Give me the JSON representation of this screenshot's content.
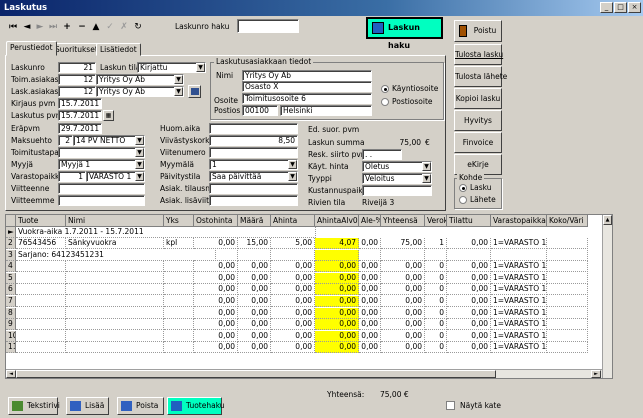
{
  "window": {
    "title": "Laskutus",
    "controls": [
      "_",
      "□",
      "×"
    ]
  },
  "toolbar": {
    "icons": [
      "first-icon",
      "prev-icon",
      "next-icon",
      "last-icon",
      "add-icon",
      "delete-icon",
      "up-icon",
      "check-icon",
      "cancel-icon",
      "refresh-icon"
    ],
    "search_label": "Laskunro haku",
    "search_value": "",
    "search_button": "Laskun haku"
  },
  "right_buttons": {
    "poistu": "Poistu",
    "tulosta_lasku": "Tulosta lasku",
    "tulosta_lahete": "Tulosta lähete",
    "kopioi_lasku": "Kopioi lasku",
    "hyvitys": "Hyvitys",
    "finvoice": "Finvoice",
    "ekirje": "eKirje"
  },
  "kohde": {
    "title": "Kohde",
    "options": [
      "Lasku",
      "Lähete"
    ],
    "selected": "Lasku"
  },
  "tabs": [
    "Perustiedot",
    "Suoritukset",
    "Lisätiedot"
  ],
  "form": {
    "laskunro": {
      "label": "Laskunro",
      "value": "21"
    },
    "laskun_tila": {
      "label": "Laskun tila",
      "value": "Kirjattu"
    },
    "toim_asiakas": {
      "label": "Toim.asiakas",
      "num": "12",
      "name": "Yritys Oy Ab"
    },
    "lask_asiakas": {
      "label": "Lask.asiakas",
      "num": "12",
      "name": "Yritys Oy Ab"
    },
    "kirjaus_pvm": {
      "label": "Kirjaus pvm",
      "value": "15.7.2011"
    },
    "laskutus_pvm": {
      "label": "Laskutus pvm",
      "value": "15.7.2011"
    },
    "erapvm": {
      "label": "Eräpvm",
      "value": "29.7.2011"
    },
    "maksuehto": {
      "label": "Maksuehto",
      "num": "2",
      "value": "14 PV NETTO"
    },
    "toimitustapa": {
      "label": "Toimitustapa",
      "value": ""
    },
    "myyja": {
      "label": "Myyjä",
      "value": "Myyjä 1"
    },
    "varastopaikka": {
      "label": "Varastopaikka",
      "num": "1",
      "value": "VARASTO 1"
    },
    "viitteenne": {
      "label": "Viitteenne",
      "value": ""
    },
    "viitteemme": {
      "label": "Viitteemme",
      "value": ""
    },
    "huom_aika": {
      "label": "Huom.aika",
      "value": ""
    },
    "viivastyskorko": {
      "label": "Viivästyskorko",
      "value": "8,50"
    },
    "viitenumero": {
      "label": "Viitenumero",
      "value": ""
    },
    "myymala": {
      "label": "Myymälä",
      "value": "1"
    },
    "paivitystila": {
      "label": "Päivitystila",
      "value": "Saa päivittää"
    },
    "asiak_tilausnro": {
      "label": "Asiak. tilausnro",
      "value": ""
    },
    "asiak_lisaviite": {
      "label": "Asiak. lisäviite",
      "value": ""
    },
    "ed_suor_pvm": {
      "label": "Ed. suor. pvm",
      "value": ""
    },
    "laskun_summa": {
      "label": "Laskun summa",
      "value": "75,00",
      "unit": "€"
    },
    "resk_siirto_pvm": {
      "label": "Resk. siirto pvm",
      "value": ". ."
    },
    "kayt_hinta": {
      "label": "Käyt. hinta",
      "value": "Oletus"
    },
    "tyyppi": {
      "label": "Tyyppi",
      "value": "Veloitus"
    },
    "kustannuspaik": {
      "label": "Kustannuspaik.",
      "value": ""
    },
    "rivien_tila": {
      "label": "Rivien tila",
      "value": "Riveijä 3"
    }
  },
  "address": {
    "title": "Laskutusasiakkaan tiedot",
    "nimi_label": "Nimi",
    "nimi": "Yritys Oy Ab",
    "nimi2": "Osasto X",
    "osoite_label": "Osoite",
    "osoite": "Toimitusosoite 6",
    "postios_label": "Postios",
    "postinro": "00100",
    "postitmp": "Helsinki",
    "radio": [
      "Käyntiosoite",
      "Postiosoite"
    ],
    "radio_selected": "Käyntiosoite"
  },
  "grid": {
    "columns": [
      "Tuote",
      "Nimi",
      "Yks",
      "Ostohinta",
      "Määrä",
      "Ahinta",
      "AhintaAlv0",
      "Ale-%",
      "Yhteensä",
      "Verok",
      "Tilattu",
      "Varastopaikka",
      "Koko/Väri"
    ],
    "row_labels": [
      "2",
      "3",
      "4",
      "5",
      "6",
      "7",
      "8",
      "9",
      "10",
      "11"
    ],
    "header_row": {
      "marker": "►",
      "tuote": "Vuokra-aika 1.7.2011 - 15.7.2011"
    },
    "rows": [
      {
        "tuote": "76543456",
        "nimi": "Sänkyvuokra",
        "yks": "kpl",
        "ostohinta": "0,00",
        "maara": "15,00",
        "ahinta": "5,00",
        "ahinta0": "4,07",
        "ale": "0,00",
        "yhteensa": "75,00",
        "verok": "1",
        "tilattu": "0,00",
        "varasto": "1=VARASTO 1"
      },
      {
        "tuote": "Sarjano: 64123451231"
      },
      {
        "ostohinta": "0,00",
        "maara": "0,00",
        "ahinta": "0,00",
        "ahinta0": "0,00",
        "ale": "0,00",
        "yhteensa": "0,00",
        "verok": "0",
        "tilattu": "0,00",
        "varasto": "1=VARASTO 1"
      },
      {
        "ostohinta": "0,00",
        "maara": "0,00",
        "ahinta": "0,00",
        "ahinta0": "0,00",
        "ale": "0,00",
        "yhteensa": "0,00",
        "verok": "0",
        "tilattu": "0,00",
        "varasto": "1=VARASTO 1"
      },
      {
        "ostohinta": "0,00",
        "maara": "0,00",
        "ahinta": "0,00",
        "ahinta0": "0,00",
        "ale": "0,00",
        "yhteensa": "0,00",
        "verok": "0",
        "tilattu": "0,00",
        "varasto": "1=VARASTO 1"
      },
      {
        "ostohinta": "0,00",
        "maara": "0,00",
        "ahinta": "0,00",
        "ahinta0": "0,00",
        "ale": "0,00",
        "yhteensa": "0,00",
        "verok": "0",
        "tilattu": "0,00",
        "varasto": "1=VARASTO 1"
      },
      {
        "ostohinta": "0,00",
        "maara": "0,00",
        "ahinta": "0,00",
        "ahinta0": "0,00",
        "ale": "0,00",
        "yhteensa": "0,00",
        "verok": "0",
        "tilattu": "0,00",
        "varasto": "1=VARASTO 1"
      },
      {
        "ostohinta": "0,00",
        "maara": "0,00",
        "ahinta": "0,00",
        "ahinta0": "0,00",
        "ale": "0,00",
        "yhteensa": "0,00",
        "verok": "0",
        "tilattu": "0,00",
        "varasto": "1=VARASTO 1"
      },
      {
        "ostohinta": "0,00",
        "maara": "0,00",
        "ahinta": "0,00",
        "ahinta0": "0,00",
        "ale": "0,00",
        "yhteensa": "0,00",
        "verok": "0",
        "tilattu": "0,00",
        "varasto": "1=VARASTO 1"
      },
      {
        "ostohinta": "0,00",
        "maara": "0,00",
        "ahinta": "0,00",
        "ahinta0": "0,00",
        "ale": "0,00",
        "yhteensa": "0,00",
        "verok": "0",
        "tilattu": "0,00",
        "varasto": "1=VARASTO 1"
      }
    ]
  },
  "footer": {
    "yhteensa_label": "Yhteensä:",
    "yhteensa": "75,00 €",
    "nayta_kate": "Näytä kate",
    "buttons": [
      "Tekstirivi",
      "Lisää",
      "Poista",
      "Tuotehaku"
    ]
  },
  "colors": {
    "title_bar": "#0a246a",
    "highlight": "#ffff00",
    "search_button": "#00ffc0"
  }
}
